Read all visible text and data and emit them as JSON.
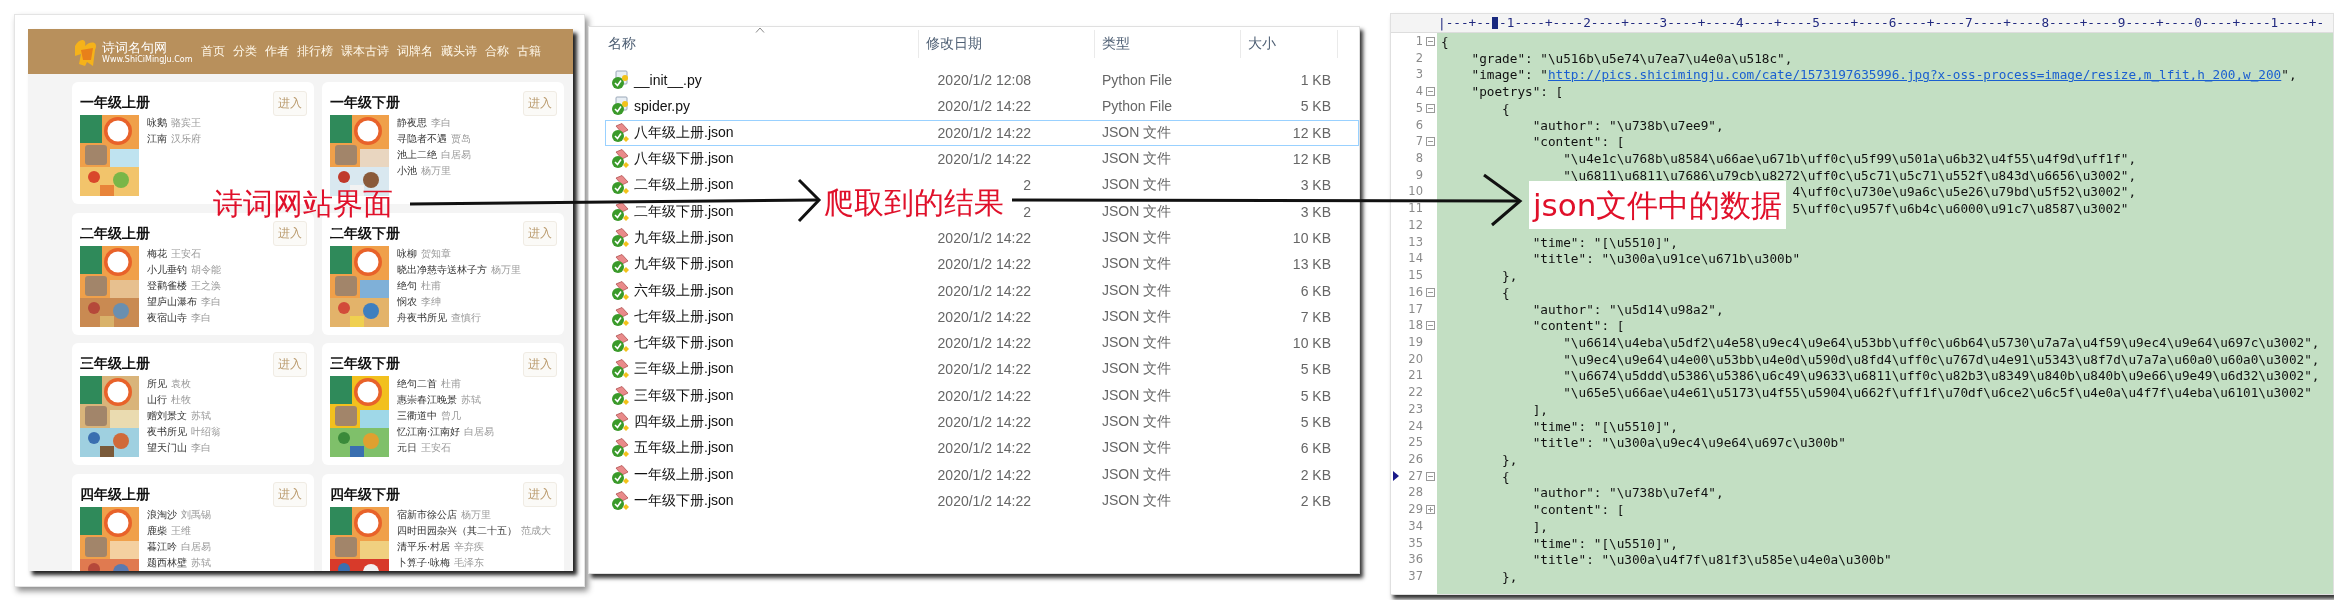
{
  "annotations": [
    {
      "text": "诗词网站界面"
    },
    {
      "text": "爬取到的结果"
    },
    {
      "text": "json文件中的数据"
    }
  ],
  "website": {
    "logo": {
      "title": "诗词名句网",
      "subtitle": "Www.ShiCiMingJu.Com"
    },
    "nav": [
      "首页",
      "分类",
      "作者",
      "排行榜",
      "课本古诗",
      "词牌名",
      "藏头诗",
      "合称",
      "古籍"
    ],
    "cards": [
      {
        "title": "一年级上册",
        "button": "进入",
        "cover": {
          "kind": "picture"
        },
        "poems": [
          {
            "title": "咏鹅",
            "author": "骆宾王"
          },
          {
            "title": "江南",
            "author": "汉乐府"
          }
        ]
      },
      {
        "title": "一年级下册",
        "button": "进入",
        "cover": {
          "kind": "picture"
        },
        "poems": [
          {
            "title": "静夜思",
            "author": "李白"
          },
          {
            "title": "寻隐者不遇",
            "author": "贾岛"
          },
          {
            "title": "池上二绝",
            "author": "白居易"
          },
          {
            "title": "小池",
            "author": "杨万里"
          }
        ]
      },
      {
        "title": "二年级上册",
        "button": "进入",
        "cover": {
          "kind": "picture"
        },
        "poems": [
          {
            "title": "梅花",
            "author": "王安石"
          },
          {
            "title": "小儿垂钓",
            "author": "胡令能"
          },
          {
            "title": "登鹳雀楼",
            "author": "王之涣"
          },
          {
            "title": "望庐山瀑布",
            "author": "李白"
          },
          {
            "title": "夜宿山寺",
            "author": "李白"
          }
        ]
      },
      {
        "title": "二年级下册",
        "button": "进入",
        "cover": {
          "kind": "picture"
        },
        "poems": [
          {
            "title": "咏柳",
            "author": "贺知章"
          },
          {
            "title": "晓出净慈寺送林子方",
            "author": "杨万里"
          },
          {
            "title": "绝句",
            "author": "杜甫"
          },
          {
            "title": "悯农",
            "author": "李绅"
          },
          {
            "title": "舟夜书所见",
            "author": "查慎行"
          }
        ]
      },
      {
        "title": "三年级上册",
        "button": "进入",
        "cover": {
          "kind": "picture"
        },
        "poems": [
          {
            "title": "所见",
            "author": "袁枚"
          },
          {
            "title": "山行",
            "author": "杜牧"
          },
          {
            "title": "赠刘景文",
            "author": "苏轼"
          },
          {
            "title": "夜书所见",
            "author": "叶绍翁"
          },
          {
            "title": "望天门山",
            "author": "李白"
          }
        ]
      },
      {
        "title": "三年级下册",
        "button": "进入",
        "cover": {
          "kind": "picture"
        },
        "poems": [
          {
            "title": "绝句二首",
            "author": "杜甫"
          },
          {
            "title": "惠崇春江晚景",
            "author": "苏轼"
          },
          {
            "title": "三衢道中",
            "author": "曾几"
          },
          {
            "title": "忆江南·江南好",
            "author": "白居易"
          },
          {
            "title": "元日",
            "author": "王安石"
          }
        ]
      },
      {
        "title": "四年级上册",
        "button": "进入",
        "cover": {
          "kind": "picture"
        },
        "poems": [
          {
            "title": "浪淘沙",
            "author": "刘禹锡"
          },
          {
            "title": "鹿柴",
            "author": "王维"
          },
          {
            "title": "暮江吟",
            "author": "白居易"
          },
          {
            "title": "题西林壁",
            "author": "苏轼"
          }
        ]
      },
      {
        "title": "四年级下册",
        "button": "进入",
        "cover": {
          "kind": "picture"
        },
        "poems": [
          {
            "title": "宿新市徐公店",
            "author": "杨万里"
          },
          {
            "title": "四时田园杂兴（其二十五）",
            "author": "范成大"
          },
          {
            "title": "清平乐·村居",
            "author": "辛弃疾"
          },
          {
            "title": "卜算子·咏梅",
            "author": "毛泽东"
          }
        ]
      }
    ]
  },
  "explorer": {
    "columns": [
      {
        "label": "名称",
        "sorted": true
      },
      {
        "label": "修改日期",
        "sorted": false
      },
      {
        "label": "类型",
        "sorted": false
      },
      {
        "label": "大小",
        "sorted": false
      }
    ],
    "files": [
      {
        "kind": "python",
        "name": "__init__.py",
        "modified": "2020/1/2 12:08",
        "type": "Python File",
        "size": "1 KB",
        "selected": false
      },
      {
        "kind": "python",
        "name": "spider.py",
        "modified": "2020/1/2 14:22",
        "type": "Python File",
        "size": "5 KB",
        "selected": false
      },
      {
        "kind": "json",
        "name": "八年级上册.json",
        "modified": "2020/1/2 14:22",
        "type": "JSON 文件",
        "size": "12 KB",
        "selected": true
      },
      {
        "kind": "json",
        "name": "八年级下册.json",
        "modified": "2020/1/2 14:22",
        "type": "JSON 文件",
        "size": "12 KB",
        "selected": false
      },
      {
        "kind": "json",
        "name": "二年级上册.json",
        "modified": "2",
        "type": "JSON 文件",
        "size": "3 KB",
        "selected": false
      },
      {
        "kind": "json",
        "name": "二年级下册.json",
        "modified": "2",
        "type": "JSON 文件",
        "size": "3 KB",
        "selected": false
      },
      {
        "kind": "json",
        "name": "九年级上册.json",
        "modified": "2020/1/2 14:22",
        "type": "JSON 文件",
        "size": "10 KB",
        "selected": false
      },
      {
        "kind": "json",
        "name": "九年级下册.json",
        "modified": "2020/1/2 14:22",
        "type": "JSON 文件",
        "size": "13 KB",
        "selected": false
      },
      {
        "kind": "json",
        "name": "六年级上册.json",
        "modified": "2020/1/2 14:22",
        "type": "JSON 文件",
        "size": "6 KB",
        "selected": false
      },
      {
        "kind": "json",
        "name": "七年级上册.json",
        "modified": "2020/1/2 14:22",
        "type": "JSON 文件",
        "size": "7 KB",
        "selected": false
      },
      {
        "kind": "json",
        "name": "七年级下册.json",
        "modified": "2020/1/2 14:22",
        "type": "JSON 文件",
        "size": "10 KB",
        "selected": false
      },
      {
        "kind": "json",
        "name": "三年级上册.json",
        "modified": "2020/1/2 14:22",
        "type": "JSON 文件",
        "size": "5 KB",
        "selected": false
      },
      {
        "kind": "json",
        "name": "三年级下册.json",
        "modified": "2020/1/2 14:22",
        "type": "JSON 文件",
        "size": "5 KB",
        "selected": false
      },
      {
        "kind": "json",
        "name": "四年级上册.json",
        "modified": "2020/1/2 14:22",
        "type": "JSON 文件",
        "size": "5 KB",
        "selected": false
      },
      {
        "kind": "json",
        "name": "五年级上册.json",
        "modified": "2020/1/2 14:22",
        "type": "JSON 文件",
        "size": "6 KB",
        "selected": false
      },
      {
        "kind": "json",
        "name": "一年级上册.json",
        "modified": "2020/1/2 14:22",
        "type": "JSON 文件",
        "size": "2 KB",
        "selected": false
      },
      {
        "kind": "json",
        "name": "一年级下册.json",
        "modified": "2020/1/2 14:22",
        "type": "JSON 文件",
        "size": "2 KB",
        "selected": false
      }
    ]
  },
  "editor": {
    "ruler": "|---+-- -1----+----2----+----3----+----4----+----5----+----6----+----7----+----8----+----9----+----0----+----1----+-",
    "lines": [
      {
        "number": "1",
        "kind": "fold",
        "marker": false,
        "text": "{"
      },
      {
        "number": "2",
        "kind": "plain",
        "marker": false,
        "text": "    \"grade\": \"\\u516b\\u5e74\\u7ea7\\u4e0a\\u518c\","
      },
      {
        "number": "3",
        "kind": "plain",
        "marker": false,
        "text": "    \"image\": \"",
        "link": "http://pics.shicimingju.com/cate/1573197635996.jpg?x-oss-process=image/resize,m_lfit,h_200,w_200",
        "after": "\","
      },
      {
        "number": "4",
        "kind": "fold",
        "marker": false,
        "text": "    \"poetrys\": ["
      },
      {
        "number": "5",
        "kind": "fold",
        "marker": false,
        "text": "        {"
      },
      {
        "number": "6",
        "kind": "plain",
        "marker": false,
        "text": "            \"author\": \"\\u738b\\u7ee9\","
      },
      {
        "number": "7",
        "kind": "fold",
        "marker": false,
        "text": "            \"content\": ["
      },
      {
        "number": "8",
        "kind": "plain",
        "marker": false,
        "text": "                \"\\u4e1c\\u768b\\u8584\\u66ae\\u671b\\uff0c\\u5f99\\u501a\\u6b32\\u4f55\\u4f9d\\uff1f\","
      },
      {
        "number": "9",
        "kind": "plain",
        "marker": false,
        "text": "                \"\\u6811\\u6811\\u7686\\u79cb\\u8272\\uff0c\\u5c71\\u5c71\\u552f\\u843d\\u6656\\u3002\","
      },
      {
        "number": "10",
        "kind": "plain",
        "marker": false,
        "text": "                                              4\\uff0c\\u730e\\u9a6c\\u5e26\\u79bd\\u5f52\\u3002\","
      },
      {
        "number": "11",
        "kind": "plain",
        "marker": false,
        "text": "                                              5\\uff0c\\u957f\\u6b4c\\u6000\\u91c7\\u8587\\u3002\""
      },
      {
        "number": "12",
        "kind": "plain",
        "marker": false
      },
      {
        "number": "13",
        "kind": "plain",
        "marker": false,
        "text": "            \"time\": \"[\\u5510]\","
      },
      {
        "number": "14",
        "kind": "plain",
        "marker": false,
        "text": "            \"title\": \"\\u300a\\u91ce\\u671b\\u300b\""
      },
      {
        "number": "15",
        "kind": "plain",
        "marker": false,
        "text": "        },"
      },
      {
        "number": "16",
        "kind": "fold",
        "marker": false,
        "text": "        {"
      },
      {
        "number": "17",
        "kind": "plain",
        "marker": false,
        "text": "            \"author\": \"\\u5d14\\u98a2\","
      },
      {
        "number": "18",
        "kind": "fold",
        "marker": false,
        "text": "            \"content\": ["
      },
      {
        "number": "19",
        "kind": "plain",
        "marker": false,
        "text": "                \"\\u6614\\u4eba\\u5df2\\u4e58\\u9ec4\\u9e64\\u53bb\\uff0c\\u6b64\\u5730\\u7a7a\\u4f59\\u9ec4\\u9e64\\u697c\\u3002\","
      },
      {
        "number": "20",
        "kind": "plain",
        "marker": false,
        "text": "                \"\\u9ec4\\u9e64\\u4e00\\u53bb\\u4e0d\\u590d\\u8fd4\\uff0c\\u767d\\u4e91\\u5343\\u8f7d\\u7a7a\\u60a0\\u60a0\\u3002\","
      },
      {
        "number": "21",
        "kind": "plain",
        "marker": false,
        "text": "                \"\\u6674\\u5ddd\\u5386\\u5386\\u6c49\\u9633\\u6811\\uff0c\\u82b3\\u8349\\u840b\\u840b\\u9e66\\u9e49\\u6d32\\u3002\","
      },
      {
        "number": "22",
        "kind": "plain",
        "marker": false,
        "text": "                \"\\u65e5\\u66ae\\u4e61\\u5173\\u4f55\\u5904\\u662f\\uff1f\\u70df\\u6ce2\\u6c5f\\u4e0a\\u4f7f\\u4eba\\u6101\\u3002\""
      },
      {
        "number": "23",
        "kind": "plain",
        "marker": false,
        "text": "            ],"
      },
      {
        "number": "24",
        "kind": "plain",
        "marker": false,
        "text": "            \"time\": \"[\\u5510]\","
      },
      {
        "number": "25",
        "kind": "plain",
        "marker": false,
        "text": "            \"title\": \"\\u300a\\u9ec4\\u9e64\\u697c\\u300b\""
      },
      {
        "number": "26",
        "kind": "plain",
        "marker": false,
        "text": "        },"
      },
      {
        "number": "27",
        "kind": "fold",
        "marker": true,
        "text": "        {"
      },
      {
        "number": "28",
        "kind": "plain",
        "marker": false,
        "text": "            \"author\": \"\\u738b\\u7ef4\","
      },
      {
        "number": "29",
        "kind": "folded",
        "marker": false,
        "text": "            \"content\": ["
      },
      {
        "number": "34",
        "kind": "plain",
        "marker": false,
        "text": "            ],"
      },
      {
        "number": "35",
        "kind": "plain",
        "marker": false,
        "text": "            \"time\": \"[\\u5510]\","
      },
      {
        "number": "36",
        "kind": "plain",
        "marker": false,
        "text": "            \"title\": \"\\u300a\\u4f7f\\u81f3\\u585e\\u4e0a\\u300b\""
      },
      {
        "number": "37",
        "kind": "plain",
        "marker": false,
        "text": "        },"
      }
    ]
  }
}
